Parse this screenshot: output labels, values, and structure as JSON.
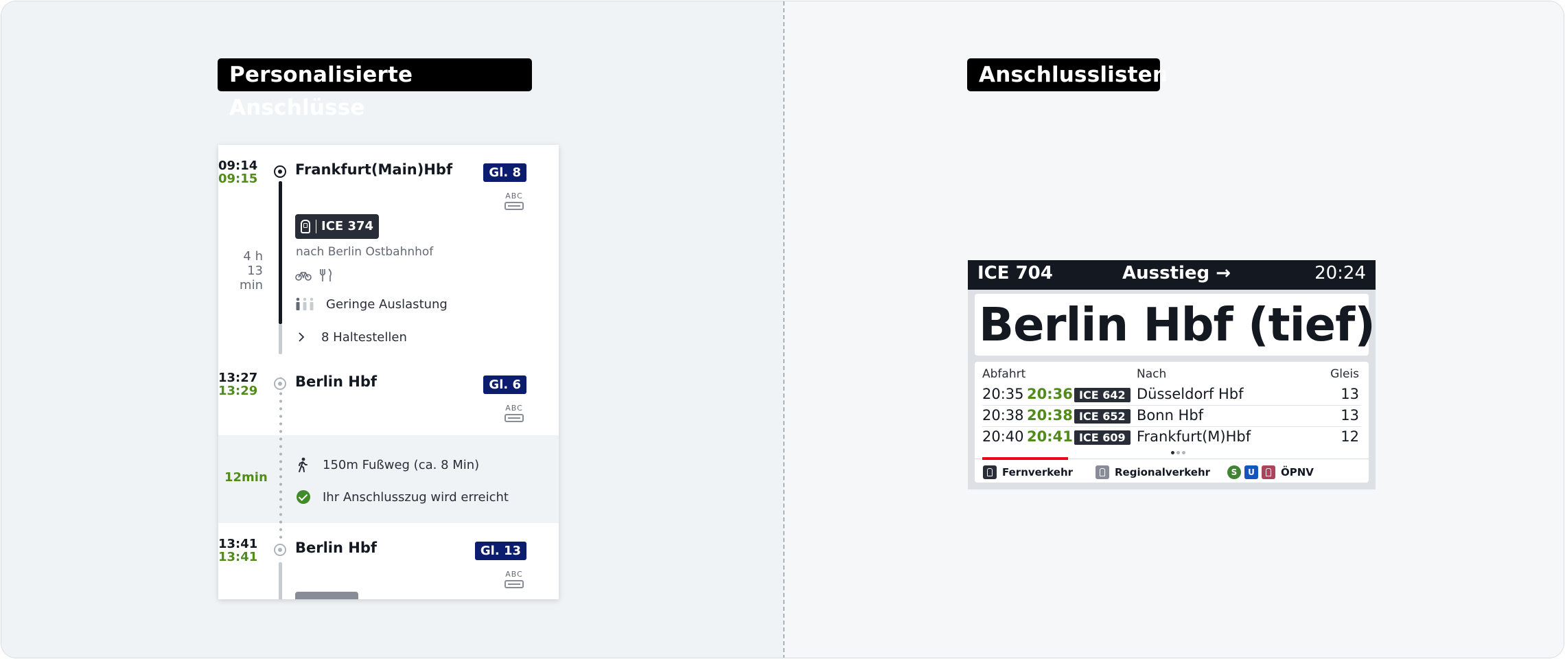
{
  "left_section": {
    "title": "Personalisierte Anschlüsse",
    "stops": [
      {
        "time_plan": "09:14",
        "time_real": "09:15",
        "name": "Frankfurt(Main)Hbf",
        "platform": "Gl. 8",
        "coach_label": "ABC"
      },
      {
        "time_plan": "13:27",
        "time_real": "13:29",
        "name": "Berlin Hbf",
        "platform": "Gl. 6",
        "coach_label": "ABC"
      },
      {
        "time_plan": "13:41",
        "time_real": "13:41",
        "name": "Berlin Hbf",
        "platform": "Gl. 13",
        "coach_label": "ABC"
      }
    ],
    "train": {
      "label": "ICE 374",
      "direction": "nach Berlin Ostbahnhof",
      "duration_hours": "4 h",
      "duration_minutes": "13 min",
      "occupancy": "Geringe Auslastung",
      "stops_toggle": "8 Haltestellen",
      "amenity_icons": [
        "bicycle-icon",
        "restaurant-icon"
      ]
    },
    "transfer": {
      "time": "12min",
      "walk": "150m Fußweg (ca. 8 Min)",
      "status": "Ihr Anschlusszug wird erreicht"
    }
  },
  "right_section": {
    "title": "Anschlusslisten",
    "board": {
      "train": "ICE 704",
      "exit": "Ausstieg →",
      "time": "20:24",
      "station": "Berlin Hbf (tief)",
      "columns": {
        "departure": "Abfahrt",
        "destination": "Nach",
        "platform": "Gleis"
      },
      "rows": [
        {
          "plan": "20:35",
          "real": "20:36",
          "train": "ICE 642",
          "dest": "Düsseldorf Hbf",
          "platform": "13"
        },
        {
          "plan": "20:38",
          "real": "20:38",
          "train": "ICE 652",
          "dest": "Bonn Hbf",
          "platform": "13"
        },
        {
          "plan": "20:40",
          "real": "20:41",
          "train": "ICE 609",
          "dest": "Frankfurt(M)Hbf",
          "platform": "12"
        }
      ],
      "legend": [
        {
          "label": "Fernverkehr",
          "color": "#282d37",
          "active": true
        },
        {
          "label": "Regionalverkehr",
          "color": "#878c96",
          "active": false
        },
        {
          "label": "ÖPNV",
          "color": "#408335",
          "active": false
        }
      ],
      "oepnv_badges": [
        {
          "text": "S",
          "color": "#408335"
        },
        {
          "text": "U",
          "color": "#1455c0"
        },
        {
          "text": "",
          "color": "#a9455d"
        }
      ],
      "pages": 3,
      "current_page": 1
    }
  },
  "colors": {
    "accent_green": "#508b1b",
    "platform_blue": "#0c1c6f",
    "db_red": "#ec0016"
  }
}
